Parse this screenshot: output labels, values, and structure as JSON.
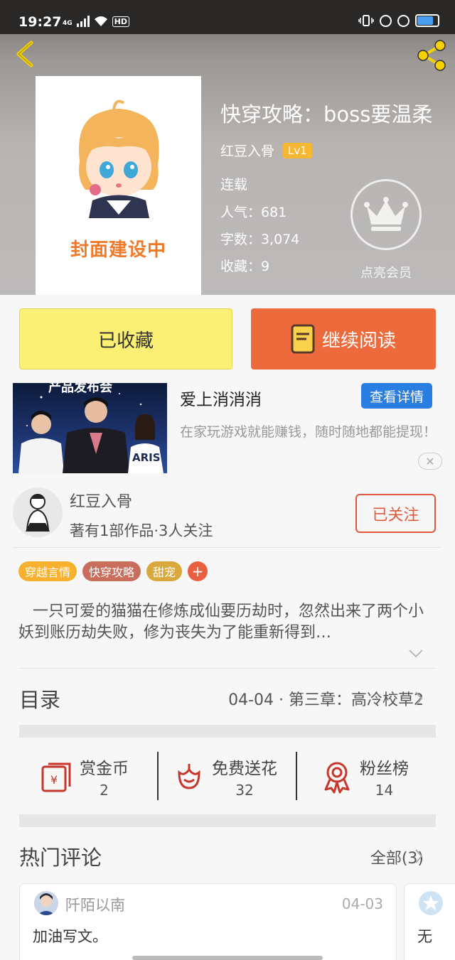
{
  "status_bar": {
    "time": "19:27",
    "network": "4G",
    "hd": "HD",
    "battery_level": 0.7
  },
  "book": {
    "title": "快穿攻略：boss要温柔",
    "author": "红豆入骨",
    "level": "Lv1",
    "status": "连载",
    "popularity": "人气：681",
    "word_count": "字数：3,074",
    "favorites": "收藏：9",
    "cover_text": "封面建设中",
    "vip_label": "点亮会员"
  },
  "actions": {
    "collected": "已收藏",
    "continue_reading": "继续阅读"
  },
  "ad": {
    "title": "爱上消消消",
    "detail_button": "查看详情",
    "description": "在家玩游戏就能赚钱，随时随地都能提现！",
    "image_caption": "产品发布会",
    "image_text": "ARIS"
  },
  "author_card": {
    "name": "红豆入骨",
    "stats": "著有1部作品·3人关注",
    "follow_button": "已关注"
  },
  "tags": [
    {
      "label": "穿越言情",
      "color": "#f7b12e"
    },
    {
      "label": "快穿攻略",
      "color": "#c96e5c"
    },
    {
      "label": "甜宠",
      "color": "#d9a93e"
    }
  ],
  "tag_add": "+",
  "synopsis": "一只可爱的猫猫在修炼成仙要历劫时，忽然出来了两个小妖到账历劫失败，修为丧失为了能重新得到…",
  "catalog": {
    "label": "目录",
    "latest": "04-04 · 第三章：高冷校草2"
  },
  "stats": [
    {
      "label": "赏金币",
      "value": "2",
      "icon": "reward-coin-icon"
    },
    {
      "label": "免费送花",
      "value": "32",
      "icon": "flower-icon"
    },
    {
      "label": "粉丝榜",
      "value": "14",
      "icon": "medal-icon"
    }
  ],
  "comments": {
    "label": "热门评论",
    "all": "全部(3)",
    "items": [
      {
        "user": "阡陌以南",
        "date": "04-03",
        "text": "加油写文。"
      },
      {
        "user": "",
        "date": "",
        "text": "无"
      }
    ]
  },
  "colors": {
    "accent_orange": "#ec6a3b",
    "collected_yellow": "#fbf074",
    "link_blue": "#2a7de1",
    "follow_red": "#e2583a"
  }
}
